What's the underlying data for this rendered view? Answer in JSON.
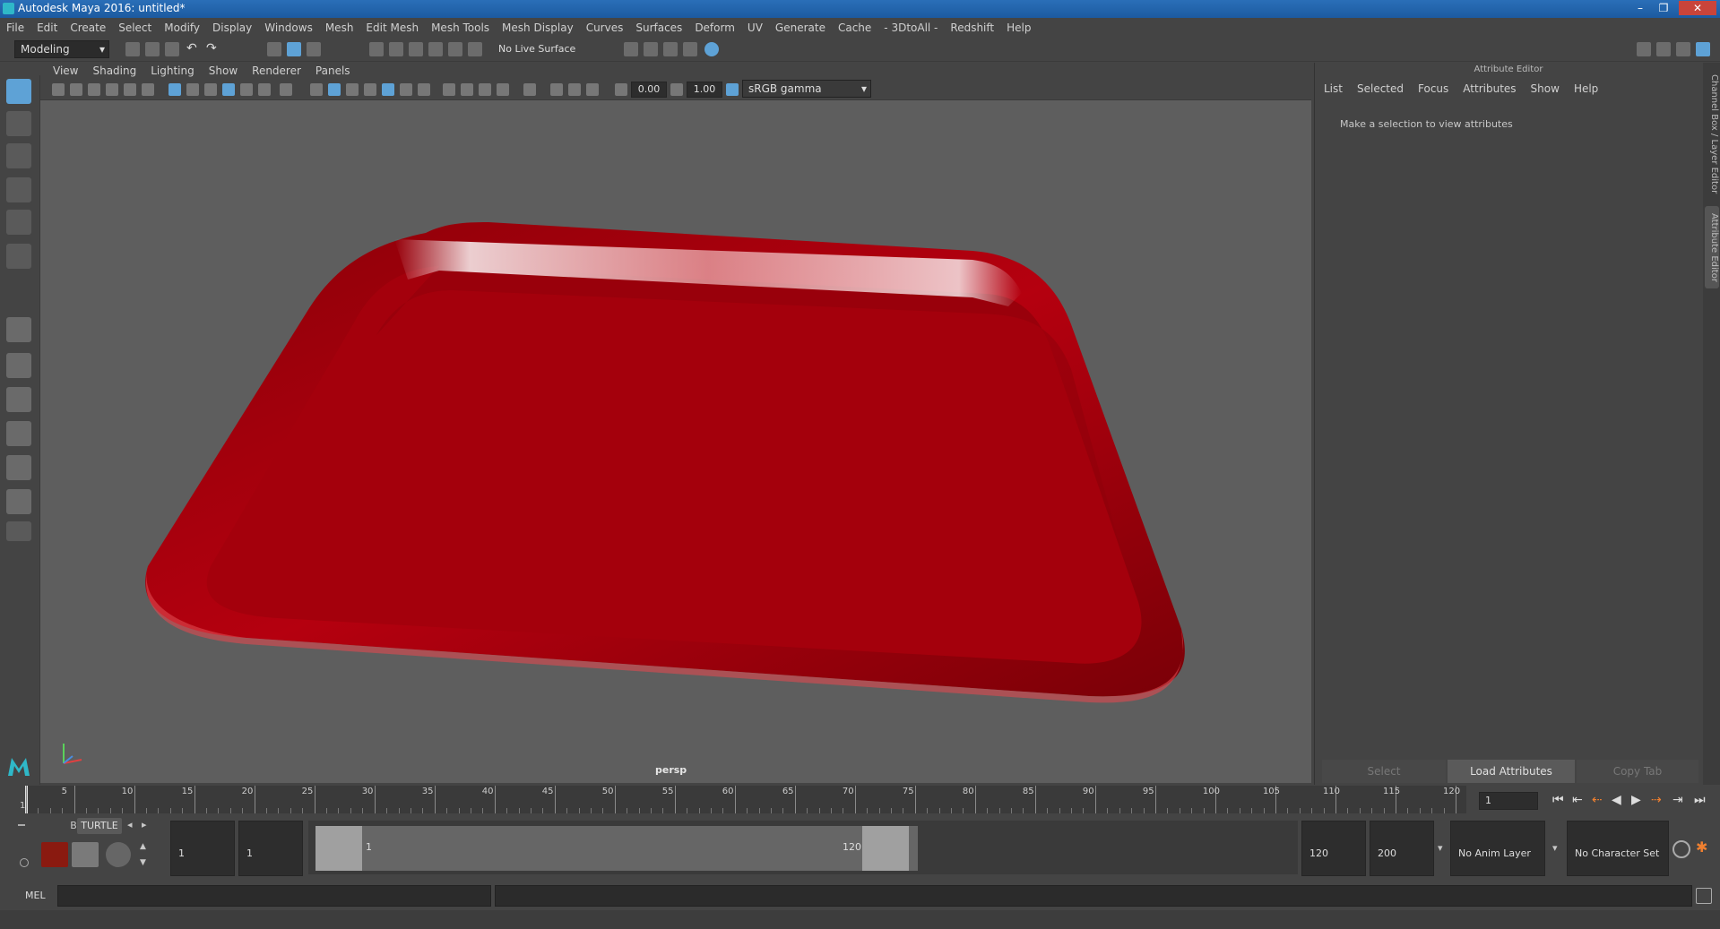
{
  "window": {
    "title": "Autodesk Maya 2016: untitled*",
    "controls": [
      "–",
      "❐",
      "✕"
    ]
  },
  "menubar": [
    "File",
    "Edit",
    "Create",
    "Select",
    "Modify",
    "Display",
    "Windows",
    "Mesh",
    "Edit Mesh",
    "Mesh Tools",
    "Mesh Display",
    "Curves",
    "Surfaces",
    "Deform",
    "UV",
    "Generate",
    "Cache",
    "- 3DtoAll -",
    "Redshift",
    "Help"
  ],
  "statusline": {
    "mode": "Modeling",
    "live_surface": "No Live Surface"
  },
  "panel": {
    "menu": [
      "View",
      "Shading",
      "Lighting",
      "Show",
      "Renderer",
      "Panels"
    ],
    "exposure": "0.00",
    "gamma": "1.00",
    "color_space": "sRGB gamma",
    "camera_label": "persp"
  },
  "attribute_editor": {
    "title": "Attribute Editor",
    "menu": [
      "List",
      "Selected",
      "Focus",
      "Attributes",
      "Show",
      "Help"
    ],
    "message": "Make a selection to view attributes",
    "buttons": {
      "select": "Select",
      "load": "Load Attributes",
      "copy": "Copy Tab"
    },
    "side_tabs": {
      "channel": "Channel Box / Layer Editor",
      "attr": "Attribute Editor"
    }
  },
  "timeline": {
    "ticks": [
      "1",
      "5",
      "10",
      "15",
      "20",
      "25",
      "30",
      "35",
      "40",
      "45",
      "50",
      "55",
      "60",
      "65",
      "70",
      "75",
      "80",
      "85",
      "90",
      "95",
      "100",
      "105",
      "110",
      "115",
      "120"
    ],
    "current_frame": "1"
  },
  "range": {
    "shelf_tabs": [
      "Bullet",
      "TURTLE"
    ],
    "start": "1",
    "playback_start": "1",
    "range_start_label": "1",
    "range_end_label": "120",
    "playback_end": "120",
    "end": "200",
    "anim_layer": "No Anim Layer",
    "character_set": "No Character Set"
  },
  "command": {
    "label": "MEL"
  },
  "colors": {
    "tray_red": "#b0000d",
    "viewport_bg": "#5e5e5e",
    "accent_blue": "#5ea2d6"
  }
}
